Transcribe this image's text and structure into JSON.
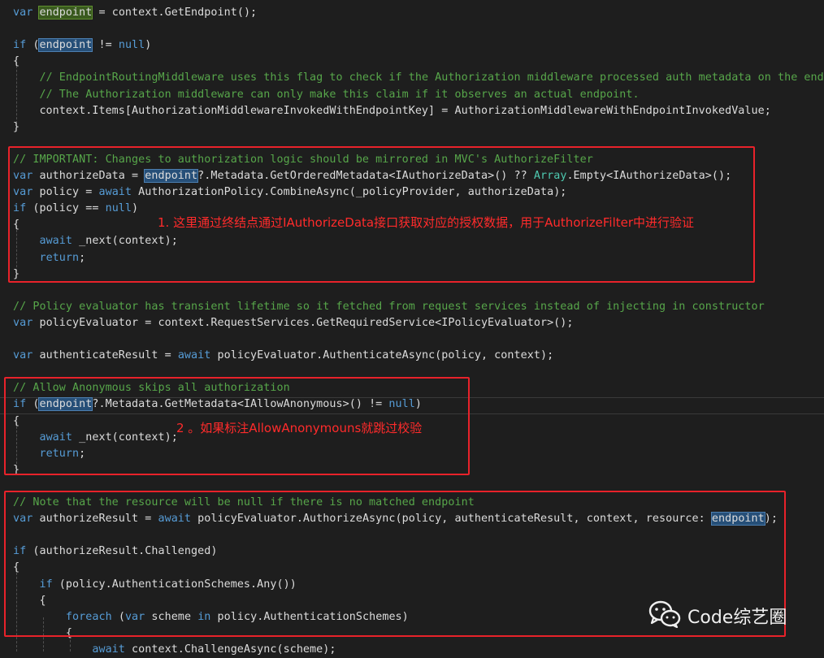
{
  "colors": {
    "background": "#1e1e1e",
    "text": "#dcdcdc",
    "keyword": "#569cd6",
    "type": "#4ec9b0",
    "comment": "#57a64a",
    "annotation": "#e8222a"
  },
  "code": [
    [
      [
        "kw",
        "var"
      ],
      [
        "t",
        " "
      ],
      [
        "hld",
        "endpoint"
      ],
      [
        "t",
        " = context.GetEndpoint();"
      ]
    ],
    [],
    [
      [
        "kw",
        "if"
      ],
      [
        "t",
        " ("
      ],
      [
        "hl",
        "endpoint"
      ],
      [
        "t",
        " != "
      ],
      [
        "kw",
        "null"
      ],
      [
        "t",
        ")"
      ]
    ],
    [
      [
        "t",
        "{"
      ]
    ],
    [
      [
        "t",
        "    "
      ],
      [
        "cm",
        "// EndpointRoutingMiddleware uses this flag to check if the Authorization middleware processed auth metadata on the endpoint."
      ]
    ],
    [
      [
        "t",
        "    "
      ],
      [
        "cm",
        "// The Authorization middleware can only make this claim if it observes an actual endpoint."
      ]
    ],
    [
      [
        "t",
        "    context.Items[AuthorizationMiddlewareInvokedWithEndpointKey] = AuthorizationMiddlewareWithEndpointInvokedValue;"
      ]
    ],
    [
      [
        "t",
        "}"
      ]
    ],
    [],
    [
      [
        "cm",
        "// IMPORTANT: Changes to authorization logic should be mirrored in MVC's AuthorizeFilter"
      ]
    ],
    [
      [
        "kw",
        "var"
      ],
      [
        "t",
        " authorizeData = "
      ],
      [
        "hl",
        "endpoint"
      ],
      [
        "t",
        "?.Metadata.GetOrderedMetadata<IAuthorizeData>() ?? "
      ],
      [
        "type",
        "Array"
      ],
      [
        "t",
        ".Empty<IAuthorizeData>();"
      ]
    ],
    [
      [
        "kw",
        "var"
      ],
      [
        "t",
        " policy = "
      ],
      [
        "kw",
        "await"
      ],
      [
        "t",
        " AuthorizationPolicy.CombineAsync(_policyProvider, authorizeData);"
      ]
    ],
    [
      [
        "kw",
        "if"
      ],
      [
        "t",
        " (policy == "
      ],
      [
        "kw",
        "null"
      ],
      [
        "t",
        ")"
      ]
    ],
    [
      [
        "t",
        "{"
      ]
    ],
    [
      [
        "t",
        "    "
      ],
      [
        "kw",
        "await"
      ],
      [
        "t",
        " _next(context);"
      ]
    ],
    [
      [
        "t",
        "    "
      ],
      [
        "kw",
        "return"
      ],
      [
        "t",
        ";"
      ]
    ],
    [
      [
        "t",
        "}"
      ]
    ],
    [],
    [
      [
        "cm",
        "// Policy evaluator has transient lifetime so it fetched from request services instead of injecting in constructor"
      ]
    ],
    [
      [
        "kw",
        "var"
      ],
      [
        "t",
        " policyEvaluator = context.RequestServices.GetRequiredService<IPolicyEvaluator>();"
      ]
    ],
    [],
    [
      [
        "kw",
        "var"
      ],
      [
        "t",
        " authenticateResult = "
      ],
      [
        "kw",
        "await"
      ],
      [
        "t",
        " policyEvaluator.AuthenticateAsync(policy, context);"
      ]
    ],
    [],
    [
      [
        "cm",
        "// Allow Anonymous skips all authorization"
      ]
    ],
    [
      [
        "kw",
        "if"
      ],
      [
        "t",
        " ("
      ],
      [
        "hl",
        "endpoint"
      ],
      [
        "t",
        "?.Metadata.GetMetadata<IAllowAnonymous>() != "
      ],
      [
        "kw",
        "null"
      ],
      [
        "t",
        ")"
      ]
    ],
    [
      [
        "t",
        "{"
      ]
    ],
    [
      [
        "t",
        "    "
      ],
      [
        "kw",
        "await"
      ],
      [
        "t",
        " _next(context);"
      ]
    ],
    [
      [
        "t",
        "    "
      ],
      [
        "kw",
        "return"
      ],
      [
        "t",
        ";"
      ]
    ],
    [
      [
        "t",
        "}"
      ]
    ],
    [],
    [
      [
        "cm",
        "// Note that the resource will be null if there is no matched endpoint"
      ]
    ],
    [
      [
        "kw",
        "var"
      ],
      [
        "t",
        " authorizeResult = "
      ],
      [
        "kw",
        "await"
      ],
      [
        "t",
        " policyEvaluator.AuthorizeAsync(policy, authenticateResult, context, resource: "
      ],
      [
        "hl",
        "endpoint"
      ],
      [
        "t",
        ");"
      ]
    ],
    [],
    [
      [
        "kw",
        "if"
      ],
      [
        "t",
        " (authorizeResult.Challenged)"
      ]
    ],
    [
      [
        "t",
        "{"
      ]
    ],
    [
      [
        "t",
        "    "
      ],
      [
        "kw",
        "if"
      ],
      [
        "t",
        " (policy.AuthenticationSchemes.Any())"
      ]
    ],
    [
      [
        "t",
        "    {"
      ]
    ],
    [
      [
        "t",
        "        "
      ],
      [
        "kw",
        "foreach"
      ],
      [
        "t",
        " ("
      ],
      [
        "kw",
        "var"
      ],
      [
        "t",
        " scheme "
      ],
      [
        "kw",
        "in"
      ],
      [
        "t",
        " policy.AuthenticationSchemes)"
      ]
    ],
    [
      [
        "t",
        "        {"
      ]
    ],
    [
      [
        "t",
        "            "
      ],
      [
        "kw",
        "await"
      ],
      [
        "t",
        " context.ChallengeAsync(scheme);"
      ]
    ]
  ],
  "annotations": {
    "note1": "1. 这里通过终结点通过IAuthorizeData接口获取对应的授权数据，用于AuthorizeFilter中进行验证",
    "note2": "2 。如果标注AllowAnonymouns就跳过校验"
  },
  "watermark": {
    "icon": "wechat-icon",
    "text": "Code综艺圈"
  }
}
